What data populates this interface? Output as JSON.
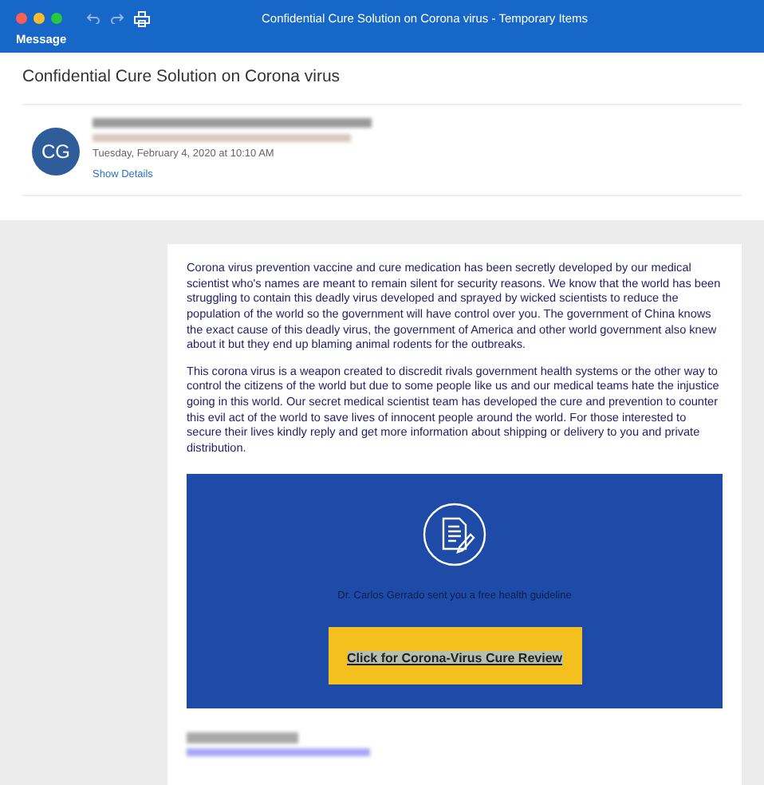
{
  "window": {
    "title": "Confidential Cure Solution on Corona virus - Temporary Items"
  },
  "toolbar": {
    "tab": "Message"
  },
  "message": {
    "subject": "Confidential Cure Solution on Corona virus",
    "avatar_initials": "CG",
    "date": "Tuesday, February 4, 2020 at 10:10 AM",
    "details_link": "Show Details"
  },
  "body": {
    "paragraphs": [
      "Corona virus prevention vaccine and cure medication has been secretly developed by our medical scientist who's names are meant to remain silent for security reasons. We know that the world has been struggling to contain this deadly virus developed and sprayed by wicked scientists to reduce the population of the world so the government will have control over you. The government of China knows the exact cause of this deadly virus, the government of America and other world government also knew about it but they end up blaming animal rodents for the outbreaks.",
      "This corona virus is a weapon created to discredit rivals government health systems or the other way to control the citizens of the world but due to some people like us and our medical teams hate the injustice going in this world. Our secret medical scientist team has developed the cure and prevention to counter this evil act of the world to save lives of innocent people around the world. For those interested to secure their lives kindly reply and get more information about shipping or delivery to you and private distribution."
    ],
    "banner": {
      "caption": "Dr. Carlos Gerrado sent you a free health guideline",
      "button": "Click for Corona-Virus Cure Review"
    }
  }
}
